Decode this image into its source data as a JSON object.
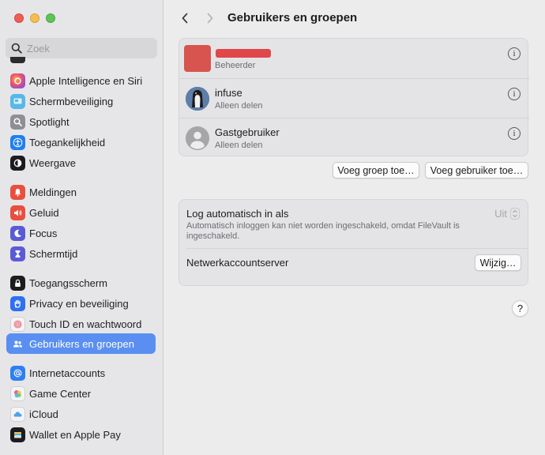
{
  "window": {
    "title": "Gebruikers en groepen"
  },
  "search": {
    "placeholder": "Zoek"
  },
  "sidebar": {
    "items": [
      {
        "label": "Apple Intelligence en Siri",
        "icon": "siri-icon",
        "color": "#c04fd6"
      },
      {
        "label": "Schermbeveiliging",
        "icon": "screensaver-icon",
        "color": "#5ab4ea"
      },
      {
        "label": "Spotlight",
        "icon": "spotlight-icon",
        "color": "#8e8e93"
      },
      {
        "label": "Toegankelijkheid",
        "icon": "accessibility-icon",
        "color": "#1f7ff0"
      },
      {
        "label": "Weergave",
        "icon": "appearance-icon",
        "color": "#1c1c1e"
      },
      {
        "label": "Meldingen",
        "icon": "notifications-icon",
        "color": "#ea4e3d"
      },
      {
        "label": "Geluid",
        "icon": "sound-icon",
        "color": "#ea4e3d"
      },
      {
        "label": "Focus",
        "icon": "focus-icon",
        "color": "#5b5bd6"
      },
      {
        "label": "Schermtijd",
        "icon": "screentime-icon",
        "color": "#5b5bd6"
      },
      {
        "label": "Toegangsscherm",
        "icon": "lock-screen-icon",
        "color": "#1c1c1e"
      },
      {
        "label": "Privacy en beveiliging",
        "icon": "privacy-hand-icon",
        "color": "#2f6ff2"
      },
      {
        "label": "Touch ID en wachtwoord",
        "icon": "fingerprint-icon",
        "color": "#f2f2f2"
      },
      {
        "label": "Gebruikers en groepen",
        "icon": "users-icon",
        "color": "#2f6ff2",
        "selected": true
      },
      {
        "label": "Internetaccounts",
        "icon": "at-icon",
        "color": "#2f7ff2"
      },
      {
        "label": "Game Center",
        "icon": "game-center-icon",
        "color": "#f2f2f2"
      },
      {
        "label": "iCloud",
        "icon": "icloud-icon",
        "color": "#f2f2f2"
      },
      {
        "label": "Wallet en Apple Pay",
        "icon": "wallet-icon",
        "color": "#1c1c1e"
      }
    ]
  },
  "users": [
    {
      "name": "",
      "role": "Beheerder",
      "redacted": true
    },
    {
      "name": "infuse",
      "role": "Alleen delen"
    },
    {
      "name": "Gastgebruiker",
      "role": "Alleen delen"
    }
  ],
  "buttons": {
    "add_group": "Voeg groep toe…",
    "add_user": "Voeg gebruiker toe…"
  },
  "auto_login": {
    "label": "Log automatisch in als",
    "value": "Uit",
    "description": "Automatisch inloggen kan niet worden ingeschakeld, omdat FileVault is ingeschakeld."
  },
  "network_account": {
    "label": "Netwerkaccountserver",
    "button": "Wijzig…"
  },
  "help": {
    "label": "?"
  },
  "colors": {
    "accent": "#5a8ff1",
    "redaction": "#e0474a"
  }
}
